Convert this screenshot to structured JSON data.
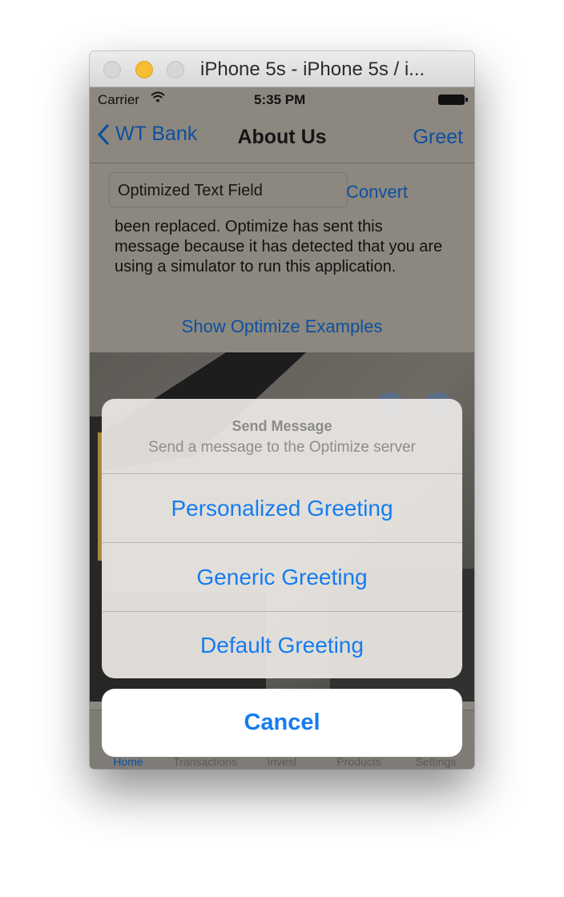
{
  "window": {
    "title": "iPhone 5s - iPhone 5s / i..."
  },
  "status": {
    "carrier": "Carrier",
    "time": "5:35 PM"
  },
  "nav": {
    "back_label": "WT Bank",
    "title": "About Us",
    "right_button": "Greet"
  },
  "content": {
    "text_field_value": "Optimized Text Field",
    "convert_label": "Convert",
    "message": "been replaced. Optimize has sent this message because it has detected that you are using a simulator to run this application.",
    "examples_link": "Show Optimize Examples"
  },
  "tabs": [
    {
      "label": "Home",
      "active": true
    },
    {
      "label": "Transactions",
      "active": false
    },
    {
      "label": "Invest",
      "active": false
    },
    {
      "label": "Products",
      "active": false
    },
    {
      "label": "Settings",
      "active": false
    }
  ],
  "action_sheet": {
    "title": "Send Message",
    "subtitle": "Send a message to the Optimize server",
    "actions": [
      "Personalized Greeting",
      "Generic Greeting",
      "Default Greeting"
    ],
    "cancel": "Cancel"
  },
  "colors": {
    "ios_blue": "#157cf0",
    "dimmed_link": "#0e4fa0",
    "traffic_yellow": "#f5bd32"
  }
}
